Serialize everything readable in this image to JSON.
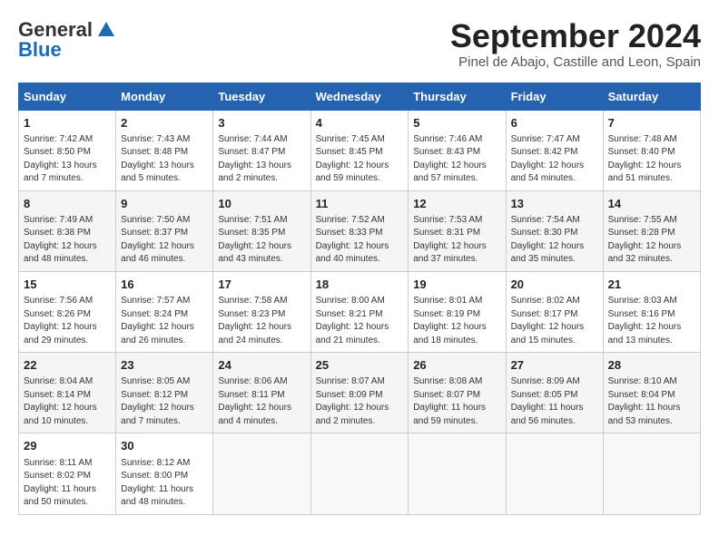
{
  "header": {
    "logo_general": "General",
    "logo_blue": "Blue",
    "month": "September 2024",
    "location": "Pinel de Abajo, Castille and Leon, Spain"
  },
  "weekdays": [
    "Sunday",
    "Monday",
    "Tuesday",
    "Wednesday",
    "Thursday",
    "Friday",
    "Saturday"
  ],
  "weeks": [
    [
      {
        "day": "1",
        "sunrise": "7:42 AM",
        "sunset": "8:50 PM",
        "daylight": "13 hours and 7 minutes."
      },
      {
        "day": "2",
        "sunrise": "7:43 AM",
        "sunset": "8:48 PM",
        "daylight": "13 hours and 5 minutes."
      },
      {
        "day": "3",
        "sunrise": "7:44 AM",
        "sunset": "8:47 PM",
        "daylight": "13 hours and 2 minutes."
      },
      {
        "day": "4",
        "sunrise": "7:45 AM",
        "sunset": "8:45 PM",
        "daylight": "12 hours and 59 minutes."
      },
      {
        "day": "5",
        "sunrise": "7:46 AM",
        "sunset": "8:43 PM",
        "daylight": "12 hours and 57 minutes."
      },
      {
        "day": "6",
        "sunrise": "7:47 AM",
        "sunset": "8:42 PM",
        "daylight": "12 hours and 54 minutes."
      },
      {
        "day": "7",
        "sunrise": "7:48 AM",
        "sunset": "8:40 PM",
        "daylight": "12 hours and 51 minutes."
      }
    ],
    [
      {
        "day": "8",
        "sunrise": "7:49 AM",
        "sunset": "8:38 PM",
        "daylight": "12 hours and 48 minutes."
      },
      {
        "day": "9",
        "sunrise": "7:50 AM",
        "sunset": "8:37 PM",
        "daylight": "12 hours and 46 minutes."
      },
      {
        "day": "10",
        "sunrise": "7:51 AM",
        "sunset": "8:35 PM",
        "daylight": "12 hours and 43 minutes."
      },
      {
        "day": "11",
        "sunrise": "7:52 AM",
        "sunset": "8:33 PM",
        "daylight": "12 hours and 40 minutes."
      },
      {
        "day": "12",
        "sunrise": "7:53 AM",
        "sunset": "8:31 PM",
        "daylight": "12 hours and 37 minutes."
      },
      {
        "day": "13",
        "sunrise": "7:54 AM",
        "sunset": "8:30 PM",
        "daylight": "12 hours and 35 minutes."
      },
      {
        "day": "14",
        "sunrise": "7:55 AM",
        "sunset": "8:28 PM",
        "daylight": "12 hours and 32 minutes."
      }
    ],
    [
      {
        "day": "15",
        "sunrise": "7:56 AM",
        "sunset": "8:26 PM",
        "daylight": "12 hours and 29 minutes."
      },
      {
        "day": "16",
        "sunrise": "7:57 AM",
        "sunset": "8:24 PM",
        "daylight": "12 hours and 26 minutes."
      },
      {
        "day": "17",
        "sunrise": "7:58 AM",
        "sunset": "8:23 PM",
        "daylight": "12 hours and 24 minutes."
      },
      {
        "day": "18",
        "sunrise": "8:00 AM",
        "sunset": "8:21 PM",
        "daylight": "12 hours and 21 minutes."
      },
      {
        "day": "19",
        "sunrise": "8:01 AM",
        "sunset": "8:19 PM",
        "daylight": "12 hours and 18 minutes."
      },
      {
        "day": "20",
        "sunrise": "8:02 AM",
        "sunset": "8:17 PM",
        "daylight": "12 hours and 15 minutes."
      },
      {
        "day": "21",
        "sunrise": "8:03 AM",
        "sunset": "8:16 PM",
        "daylight": "12 hours and 13 minutes."
      }
    ],
    [
      {
        "day": "22",
        "sunrise": "8:04 AM",
        "sunset": "8:14 PM",
        "daylight": "12 hours and 10 minutes."
      },
      {
        "day": "23",
        "sunrise": "8:05 AM",
        "sunset": "8:12 PM",
        "daylight": "12 hours and 7 minutes."
      },
      {
        "day": "24",
        "sunrise": "8:06 AM",
        "sunset": "8:11 PM",
        "daylight": "12 hours and 4 minutes."
      },
      {
        "day": "25",
        "sunrise": "8:07 AM",
        "sunset": "8:09 PM",
        "daylight": "12 hours and 2 minutes."
      },
      {
        "day": "26",
        "sunrise": "8:08 AM",
        "sunset": "8:07 PM",
        "daylight": "11 hours and 59 minutes."
      },
      {
        "day": "27",
        "sunrise": "8:09 AM",
        "sunset": "8:05 PM",
        "daylight": "11 hours and 56 minutes."
      },
      {
        "day": "28",
        "sunrise": "8:10 AM",
        "sunset": "8:04 PM",
        "daylight": "11 hours and 53 minutes."
      }
    ],
    [
      {
        "day": "29",
        "sunrise": "8:11 AM",
        "sunset": "8:02 PM",
        "daylight": "11 hours and 50 minutes."
      },
      {
        "day": "30",
        "sunrise": "8:12 AM",
        "sunset": "8:00 PM",
        "daylight": "11 hours and 48 minutes."
      },
      null,
      null,
      null,
      null,
      null
    ]
  ]
}
